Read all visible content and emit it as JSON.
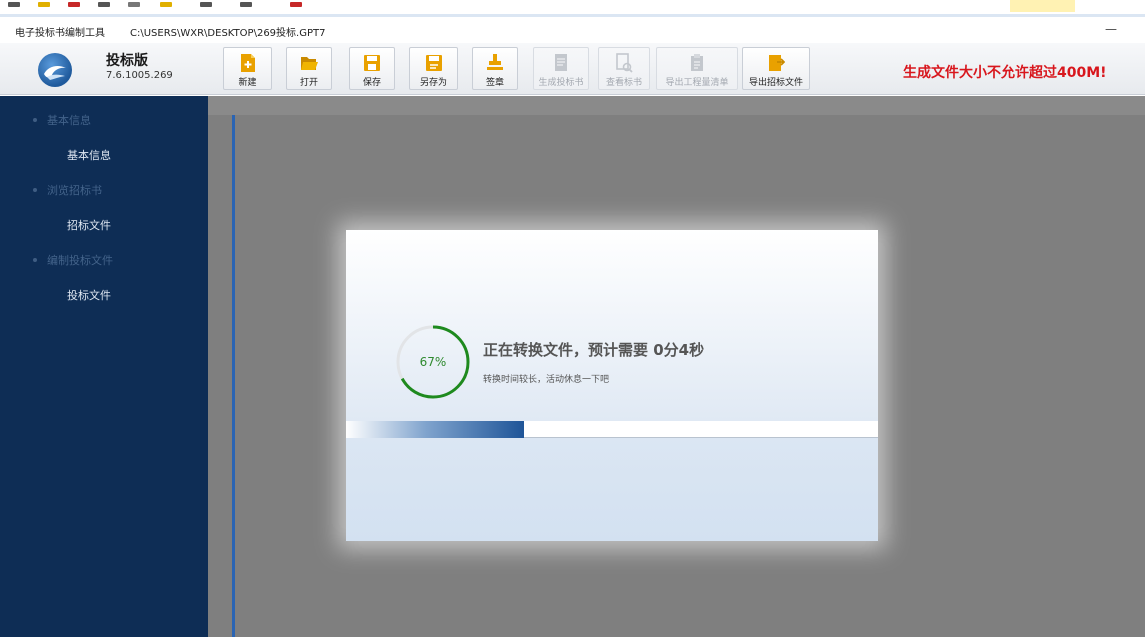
{
  "titlebar": {
    "app_title": "电子投标书编制工具",
    "file_path": "C:\\USERS\\WXR\\DESKTOP\\269投标.GPT7",
    "minimize_glyph": "—"
  },
  "header": {
    "product_name": "投标版",
    "product_version": "7.6.1005.269",
    "warning": "生成文件大小不允许超过400M!"
  },
  "toolbar": {
    "buttons": [
      {
        "label": "新建",
        "icon": "new-file-icon",
        "enabled": true
      },
      {
        "label": "打开",
        "icon": "folder-open-icon",
        "enabled": true
      },
      {
        "label": "保存",
        "icon": "save-icon",
        "enabled": true
      },
      {
        "label": "另存为",
        "icon": "save-as-icon",
        "enabled": true
      },
      {
        "label": "签章",
        "icon": "stamp-icon",
        "enabled": true
      },
      {
        "label": "生成投标书",
        "icon": "generate-bid-icon",
        "enabled": false
      },
      {
        "label": "查看标书",
        "icon": "view-bid-icon",
        "enabled": false
      },
      {
        "label": "导出工程量清单",
        "icon": "export-list-icon",
        "enabled": false
      },
      {
        "label": "导出招标文件",
        "icon": "export-tender-icon",
        "enabled": true
      }
    ]
  },
  "sidebar": {
    "sections": [
      {
        "label": "基本信息",
        "items": [
          {
            "label": "基本信息"
          }
        ]
      },
      {
        "label": "浏览招标书",
        "items": [
          {
            "label": "招标文件"
          }
        ]
      },
      {
        "label": "编制投标文件",
        "items": [
          {
            "label": "投标文件"
          }
        ]
      }
    ]
  },
  "dialog": {
    "percent_text": "67%",
    "progress": 0.67,
    "bar_progress": 0.335,
    "title": "正在转换文件，预计需要  0分4秒",
    "subtitle": "转换时间较长，活动休息一下吧"
  },
  "colors": {
    "sidebar_bg": "#0e2d55",
    "warning": "#d8161d",
    "ring_progress": "#1e8a1e",
    "bar_fill": "#1f5598"
  }
}
